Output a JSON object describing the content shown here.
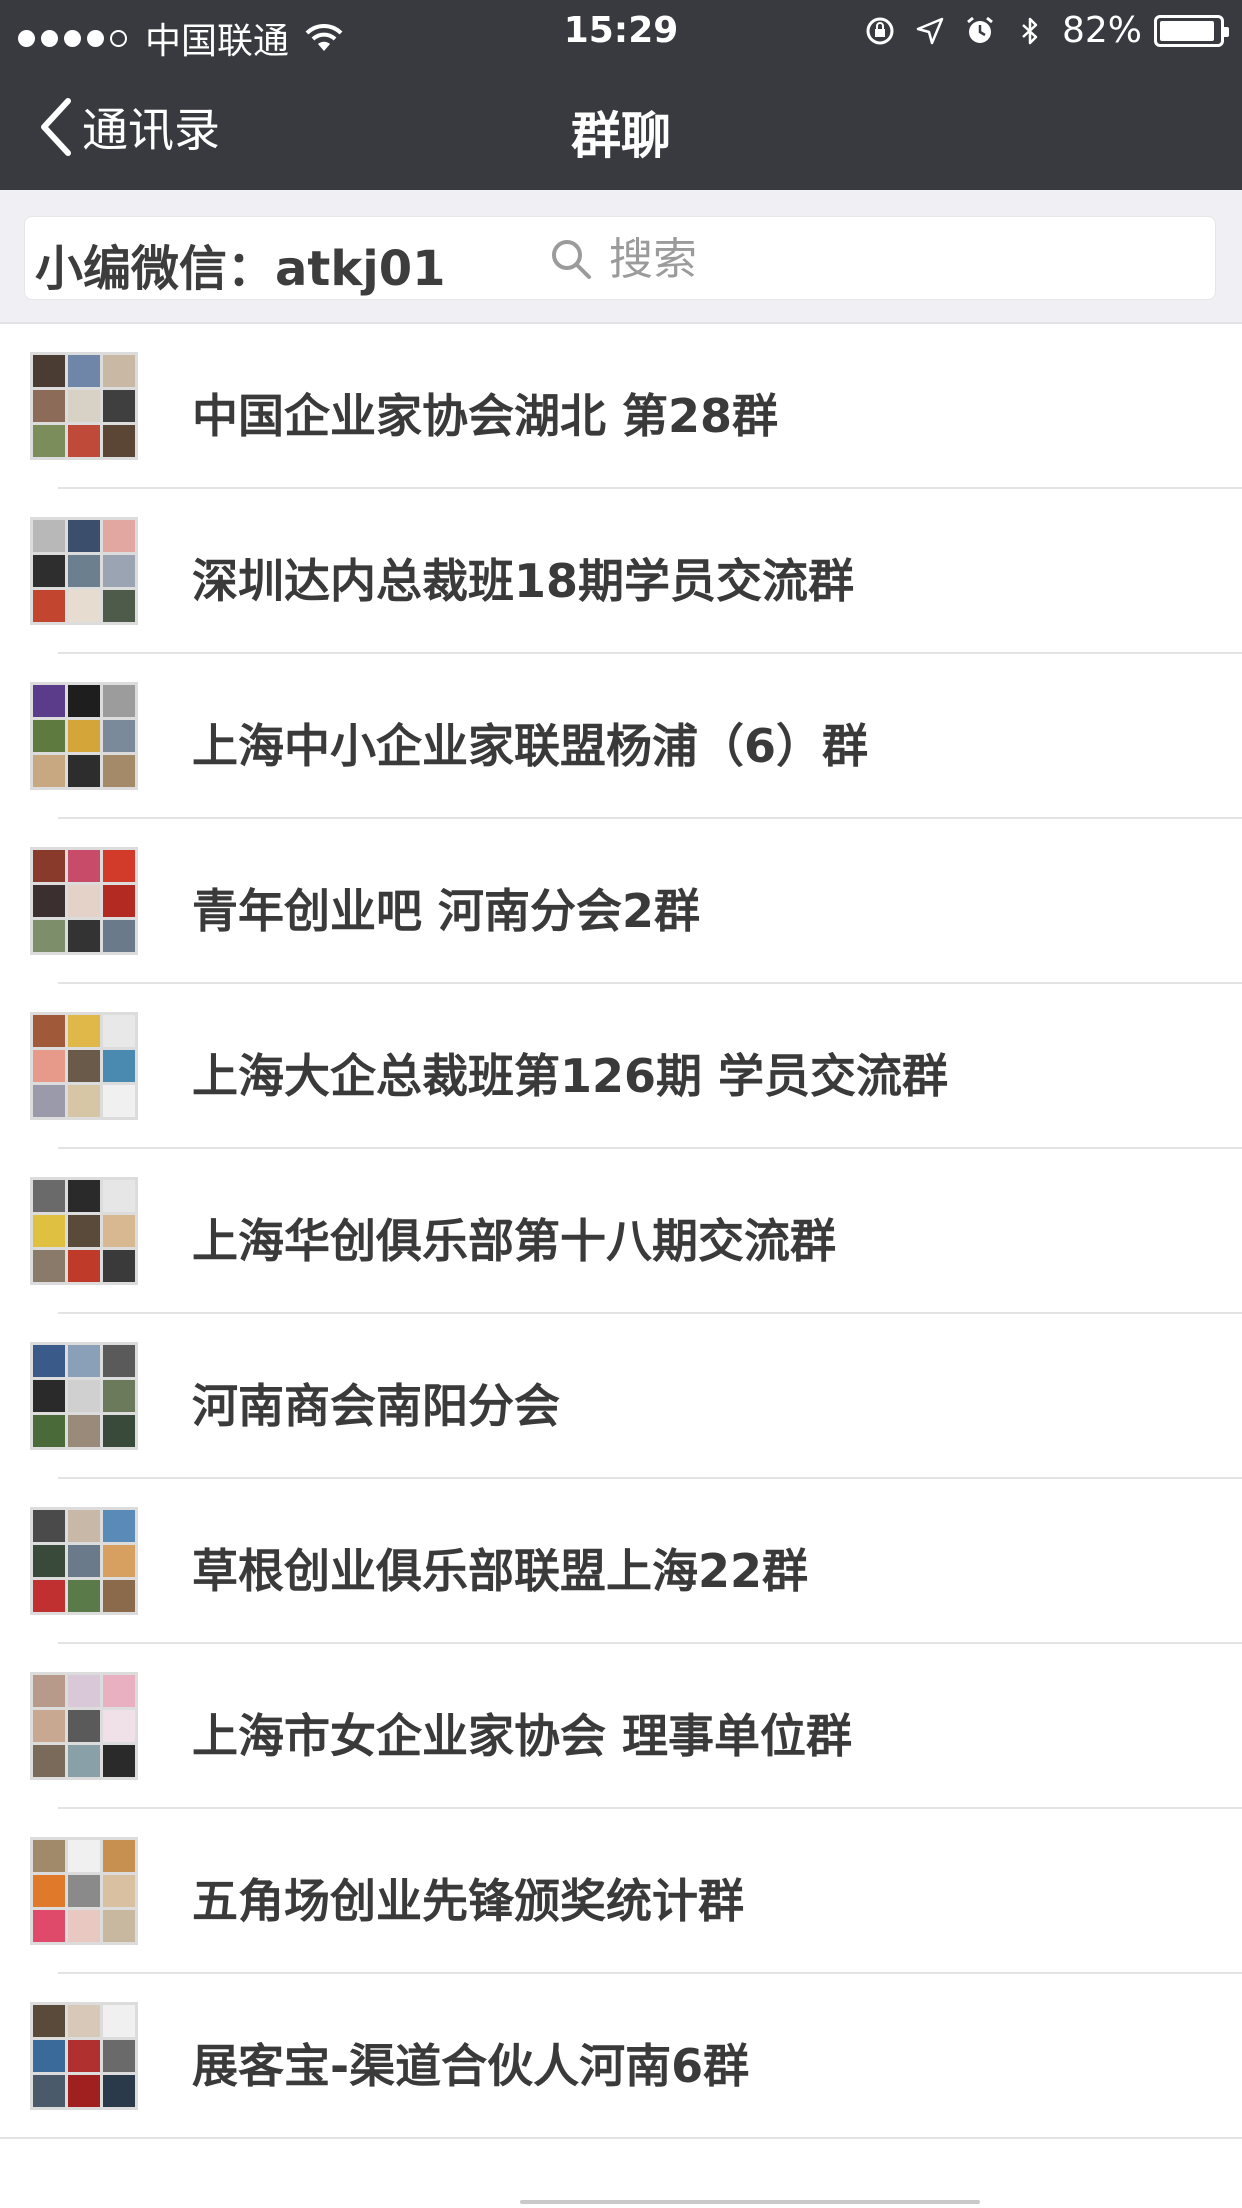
{
  "status_bar": {
    "carrier": "中国联通",
    "time": "15:29",
    "battery": "82%"
  },
  "nav": {
    "back_label": "通讯录",
    "title": "群聊"
  },
  "search": {
    "caption": "小编微信：atkj01",
    "placeholder": "搜索"
  },
  "groups": [
    {
      "name": "中国企业家协会湖北 第28群"
    },
    {
      "name": "深圳达内总裁班18期学员交流群"
    },
    {
      "name": "上海中小企业家联盟杨浦（6）群"
    },
    {
      "name": "青年创业吧 河南分会2群"
    },
    {
      "name": "上海大企总裁班第126期 学员交流群"
    },
    {
      "name": "上海华创俱乐部第十八期交流群"
    },
    {
      "name": "河南商会南阳分会"
    },
    {
      "name": "草根创业俱乐部联盟上海22群"
    },
    {
      "name": "上海市女企业家协会 理事单位群"
    },
    {
      "name": "五角场创业先锋颁奖统计群"
    },
    {
      "name": "展客宝-渠道合伙人河南6群"
    }
  ],
  "colors": {
    "nav_background": "#393a3f",
    "search_background": "#efeff4",
    "text_primary": "#3a3a3a",
    "placeholder": "#9b9b9b"
  }
}
